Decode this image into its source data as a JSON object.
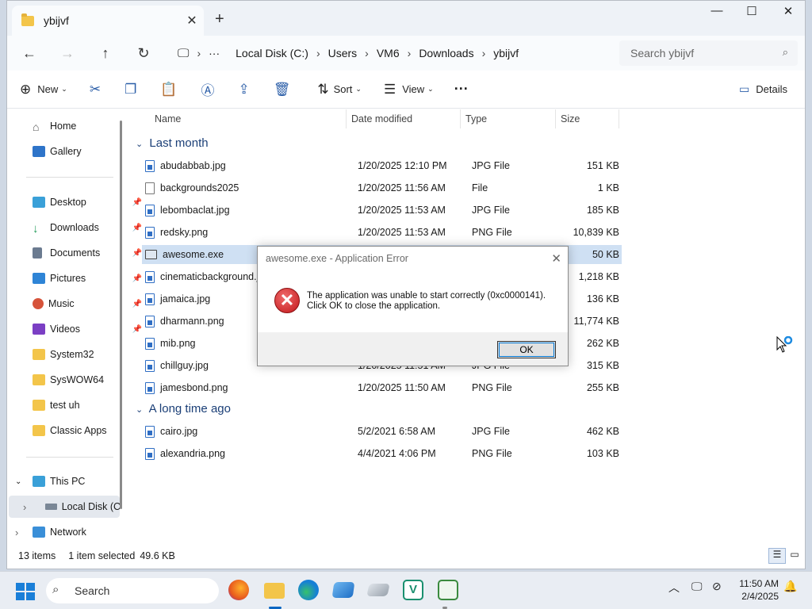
{
  "window": {
    "tab_title": "ybijvf",
    "minimize": "—",
    "maximize": "☐",
    "close": "✕"
  },
  "address": {
    "segments": [
      "Local Disk (C:)",
      "Users",
      "VM6",
      "Downloads",
      "ybijvf"
    ],
    "search_placeholder": "Search ybijvf"
  },
  "commands": {
    "new": "New",
    "sort": "Sort",
    "view": "View",
    "details": "Details"
  },
  "nav": {
    "items": [
      {
        "label": "Home",
        "icon": "home-icon",
        "pinned": false
      },
      {
        "label": "Gallery",
        "icon": "gallery-icon",
        "pinned": false
      },
      {
        "label": "Desktop",
        "icon": "desktop-icon",
        "pinned": true
      },
      {
        "label": "Downloads",
        "icon": "downloads-icon",
        "pinned": true
      },
      {
        "label": "Documents",
        "icon": "documents-icon",
        "pinned": true
      },
      {
        "label": "Pictures",
        "icon": "pictures-icon",
        "pinned": true
      },
      {
        "label": "Music",
        "icon": "music-icon",
        "pinned": true
      },
      {
        "label": "Videos",
        "icon": "videos-icon",
        "pinned": true
      },
      {
        "label": "System32",
        "icon": "folder-icon",
        "pinned": false
      },
      {
        "label": "SysWOW64",
        "icon": "folder-icon",
        "pinned": false
      },
      {
        "label": "test uh",
        "icon": "folder-icon",
        "pinned": false
      },
      {
        "label": "Classic Apps",
        "icon": "folder-icon",
        "pinned": false
      },
      {
        "label": "This PC",
        "icon": "this-pc-icon",
        "pinned": false
      },
      {
        "label": "Local Disk (C:",
        "icon": "drive-icon",
        "pinned": false
      },
      {
        "label": "Network",
        "icon": "network-icon",
        "pinned": false
      }
    ]
  },
  "columns": {
    "name": "Name",
    "date": "Date modified",
    "type": "Type",
    "size": "Size"
  },
  "groups": {
    "recent": "Last month",
    "old": "A long time ago"
  },
  "files": [
    {
      "name": "abudabbab.jpg",
      "date": "1/20/2025 12:10 PM",
      "type": "JPG File",
      "size": "151 KB",
      "icon": "img"
    },
    {
      "name": "backgrounds2025",
      "date": "1/20/2025 11:56 AM",
      "type": "File",
      "size": "1 KB",
      "icon": "plain"
    },
    {
      "name": "lebombaclat.jpg",
      "date": "1/20/2025 11:53 AM",
      "type": "JPG File",
      "size": "185 KB",
      "icon": "img"
    },
    {
      "name": "redsky.png",
      "date": "1/20/2025 11:53 AM",
      "type": "PNG File",
      "size": "10,839 KB",
      "icon": "img"
    },
    {
      "name": "awesome.exe",
      "date": "",
      "type": "",
      "size": "50 KB",
      "icon": "exe",
      "selected": true
    },
    {
      "name": "cinematicbackground.j",
      "date": "",
      "type": "",
      "size": "1,218 KB",
      "icon": "img"
    },
    {
      "name": "jamaica.jpg",
      "date": "",
      "type": "",
      "size": "136 KB",
      "icon": "img"
    },
    {
      "name": "dharmann.png",
      "date": "",
      "type": "",
      "size": "11,774 KB",
      "icon": "img"
    },
    {
      "name": "mib.png",
      "date": "",
      "type": "",
      "size": "262 KB",
      "icon": "img"
    },
    {
      "name": "chillguy.jpg",
      "date": "1/20/2025 11:51 AM",
      "type": "JPG File",
      "size": "315 KB",
      "icon": "img"
    },
    {
      "name": "jamesbond.png",
      "date": "1/20/2025 11:50 AM",
      "type": "PNG File",
      "size": "255 KB",
      "icon": "img"
    }
  ],
  "old_files": [
    {
      "name": "cairo.jpg",
      "date": "5/2/2021 6:58 AM",
      "type": "JPG File",
      "size": "462 KB",
      "icon": "img"
    },
    {
      "name": "alexandria.png",
      "date": "4/4/2021 4:06 PM",
      "type": "PNG File",
      "size": "103 KB",
      "icon": "img"
    }
  ],
  "status": {
    "count": "13 items",
    "selection": "1 item selected",
    "selection_size": "49.6 KB"
  },
  "dialog": {
    "title": "awesome.exe - Application Error",
    "message_line1": "The application was unable to start correctly (0xc0000141).",
    "message_line2": "Click OK to close the application.",
    "ok": "OK"
  },
  "taskbar": {
    "search": "Search",
    "time": "11:50 AM",
    "date": "2/4/2025"
  },
  "colors": {
    "accent": "#0a66c2",
    "selection": "#cfe0f3",
    "error": "#c2161a",
    "folder": "#f3c54a"
  }
}
